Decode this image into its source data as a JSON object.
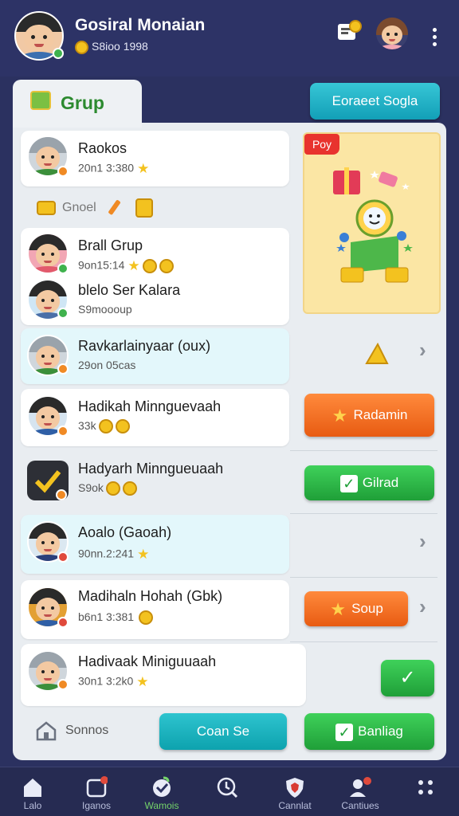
{
  "header": {
    "user_name": "Gosiral Monaian",
    "coins": "S8ioo 1998",
    "icons": [
      "avatar",
      "coupon-icon",
      "friend-avatar",
      "more-icon"
    ]
  },
  "tab": {
    "label": "Grup",
    "icon": "gift-bag-icon"
  },
  "top_button": {
    "label": "Eoraeet Sogla"
  },
  "promo": {
    "tag": "Poy",
    "icon": "prize-pile-icon"
  },
  "rows": [
    {
      "title": "Raokos",
      "sub": "20n1 3:380",
      "badge": "orange"
    },
    {
      "title": "Brall Grup",
      "sub": "9on15:14",
      "badge": "green"
    },
    {
      "title": "blelo Ser Kalara",
      "sub": "S9moooup",
      "badge": "green"
    },
    {
      "title": "Ravkarlainyaar (oux)",
      "sub": "29on 05cas",
      "badge": "orange"
    },
    {
      "title": "Hadikah Minnguevaah",
      "sub": "33k",
      "badge": "orange"
    },
    {
      "title": "Hadyarh Minngueuaah",
      "sub": "S9ok",
      "badge": "orange"
    },
    {
      "title": "Aoalo (Gaoah)",
      "sub": "90nn.2:241",
      "badge": "red"
    },
    {
      "title": "Madihaln Hohah (Gbk)",
      "sub": "b6n1 3:381",
      "badge": "red"
    },
    {
      "title": "Hadivaak Miniguuaah",
      "sub": "30n1 3:2k0",
      "badge": "orange"
    }
  ],
  "divider_label": "Gnoel",
  "actions": {
    "redeem": "Radamin",
    "gilrad": "Gilrad",
    "soup": "Soup",
    "bottom_home": "Sonnos",
    "bottom_mid": "Coan Se",
    "bottom_right": "Banliag"
  },
  "nav": [
    {
      "label": "Lalo",
      "icon": "home-icon"
    },
    {
      "label": "Iganos",
      "icon": "games-icon",
      "badge": true
    },
    {
      "label": "Wamois",
      "icon": "heart-icon",
      "active": true
    },
    {
      "label": "",
      "icon": "clock-search-icon"
    },
    {
      "label": "Cannlat",
      "icon": "shield-icon"
    },
    {
      "label": "Cantiues",
      "icon": "people-icon",
      "badge": true
    },
    {
      "label": "",
      "icon": "grid-icon"
    }
  ],
  "colors": {
    "background": "#2b3160",
    "panel": "#e9edf1",
    "accent_green": "#2c8a2f",
    "accent_orange": "#e85b12",
    "accent_teal": "#129fb7"
  }
}
